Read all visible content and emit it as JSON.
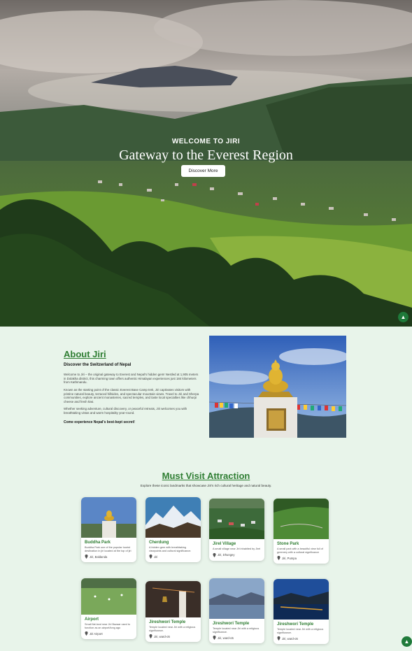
{
  "hero": {
    "welcome": "WELCOME TO JIRI",
    "title": "Gateway to the Everest Region",
    "button": "Discover More"
  },
  "about": {
    "title": "About Jiri",
    "subtitle": "Discover the Switzerland of Nepal",
    "paragraphs": [
      "Welcome to Jiri – the original gateway to Everest and Nepal's hidden gem! Nestled at 1,905 meters in Dolakha district, this charming town offers authentic Himalayan experiences just 184 kilometers from Kathmandu.",
      "Known as the starting point of the classic Everest Base Camp trek, Jiri captivates visitors with pristine natural beauty, terraced hillsides, and spectacular mountain views. Travel to Jiri and Sherpa communities, explore ancient monasteries, sacred temples, and taste local specialties like chhurpi cheese and fresh kiwi.",
      "Whether seeking adventure, cultural discovery, or peaceful retreats, Jiri welcomes you with breathtaking vistas and warm hospitality year-round."
    ],
    "cta": "Come experience Nepal's best-kept secret!"
  },
  "attractions": {
    "title": "Must Visit Attraction",
    "description": "Explore these iconic landmarks that showcase Jiri's rich cultural heritage and natural beauty.",
    "cards": [
      {
        "name": "Buddha Park",
        "desc": "Buddha Park one of the popular tourist destination in jiri located at the top of jiri",
        "location": "Jiri, Baldanda",
        "icon": "buddha-statue"
      },
      {
        "name": "Cherdung",
        "desc": "A hidden gem with breathtaking viewpoints and cultural significance.",
        "location": "Jiri",
        "icon": "snow-mountain"
      },
      {
        "name": "Jirel Village",
        "desc": "A small village near Jiri inhabited by Jirel",
        "location": "Jiri, Dhungey",
        "icon": "village"
      },
      {
        "name": "Stone Park",
        "desc": "A small park with a beautiful view full of greenery with a cultural significance",
        "location": "Jiri, Pumpa",
        "icon": "green-hill"
      },
      {
        "name": "Airport",
        "desc": "Small flat land near Jiri Bazaar used to function as an airport/long ago",
        "location": "Jiri Airport",
        "icon": "grassland"
      },
      {
        "name": "Jireshwori Temple",
        "desc": "Temple located near Jiri with a religious significance.",
        "location": "Jiri, ward-o5",
        "icon": "temple-bell"
      },
      {
        "name": "Jireshwori Temple",
        "desc": "Temple located near Jiri with a religious significance.",
        "location": "Jiri, ward-o5",
        "icon": "lake-view"
      },
      {
        "name": "Jireshwori Temple",
        "desc": "Temple located near Jiri with a religious significance.",
        "location": "Jiri, ward-o5",
        "icon": "lake-sunset"
      }
    ]
  },
  "colors": {
    "accent": "#2e7d32",
    "background": "#e8f4ea",
    "scroll_button": "#1f7a3a"
  }
}
